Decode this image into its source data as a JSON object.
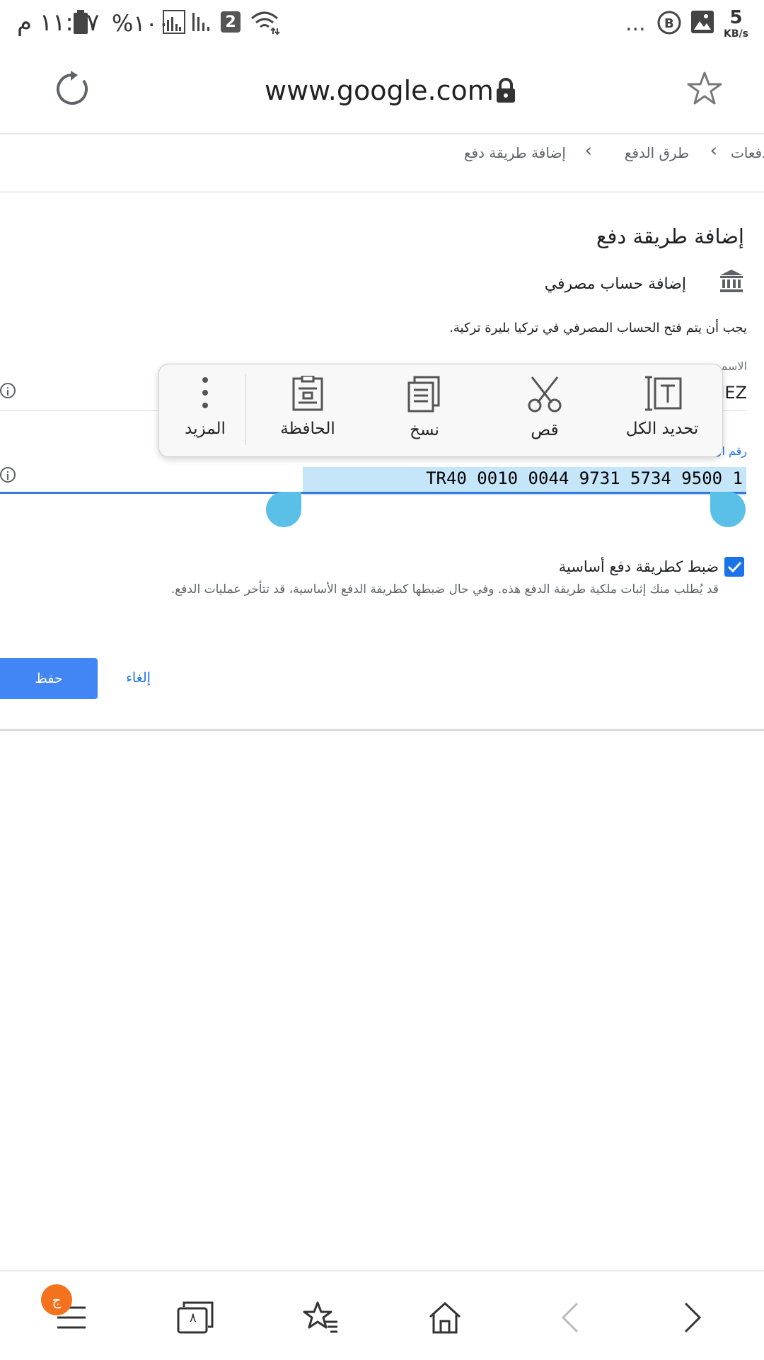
{
  "status_bar": {
    "time": "١١:٤٧ م",
    "battery_percent": "%١٠٠",
    "sim_badge": "2",
    "overflow": "...",
    "net_speed_value": "5",
    "net_speed_unit": "KB/s",
    "icons": [
      "battery-icon",
      "signal-icon",
      "signal-icon",
      "sim-2-icon",
      "wifi-icon",
      "overflow-icon",
      "b-app-icon",
      "image-icon"
    ]
  },
  "url_bar": {
    "url": "www.google.com",
    "icons": [
      "reload-icon",
      "lock-icon",
      "star-icon"
    ]
  },
  "breadcrumb": {
    "items": [
      "دفعات",
      "طرق الدفع",
      "إضافة طريقة دفع"
    ],
    "separator": "›"
  },
  "form": {
    "title": "إضافة طريقة دفع",
    "bank_account_label": "إضافة حساب مصرفي",
    "notice": "يجب أن يتم فتح الحساب المصرفي في تركيا بليرة تركية.",
    "name_field": {
      "label_fragment": "الاسم",
      "value_fragment": "IEZ"
    },
    "iban_field": {
      "label_fragment": "رقم ال",
      "value": "TR40 0010 0044 9731 5734 9500 1"
    },
    "default_checkbox": {
      "checked": true,
      "label": "ضبط كطريقة دفع أساسية",
      "description": "قد يُطلب منك إثبات ملكية طريقة الدفع هذه. وفي حال ضبطها كطريقة الدفع الأساسية، قد تتأخر عمليات الدفع."
    },
    "save_label": "حفظ",
    "cancel_label": "إلغاء"
  },
  "context_menu": {
    "select_all": "تحديد الكل",
    "cut": "قص",
    "copy": "نسخ",
    "clipboard": "الحافظة",
    "more": "المزيد"
  },
  "bottom_nav": {
    "badge": "ج",
    "icons": [
      "menu-icon",
      "tabs-icon",
      "bookmarks-icon",
      "home-icon",
      "back-icon",
      "forward-icon"
    ],
    "tabs_count": "٨"
  },
  "colors": {
    "accent": "#1a73e8",
    "save_button": "#4285f4",
    "selection": "#c5e6f9",
    "selection_handle": "#5ac0e8",
    "badge": "#f4711e"
  }
}
